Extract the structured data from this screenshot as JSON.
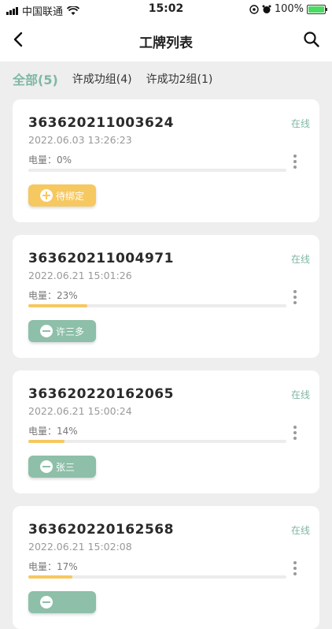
{
  "status_bar": {
    "carrier": "中国联通",
    "time": "15:02",
    "battery": "100%"
  },
  "header": {
    "title": "工牌列表"
  },
  "tabs": [
    {
      "label": "全部(5)",
      "active": true
    },
    {
      "label": "许成功组(4)",
      "active": false
    },
    {
      "label": "许成功2组(1)",
      "active": false
    }
  ],
  "cards": [
    {
      "id": "363620211003624",
      "time": "2022.06.03 13:26:23",
      "status": "在线",
      "battery_label": "电量：0%",
      "battery_level": 0,
      "tag": "待绑定",
      "tag_type": "pending"
    },
    {
      "id": "363620211004971",
      "time": "2022.06.21 15:01:26",
      "status": "在线",
      "battery_label": "电量：23%",
      "battery_level": 23,
      "tag": "许三多",
      "tag_type": "bound"
    },
    {
      "id": "363620220162065",
      "time": "2022.06.21 15:00:24",
      "status": "在线",
      "battery_label": "电量：14%",
      "battery_level": 14,
      "tag": "张三",
      "tag_type": "bound"
    },
    {
      "id": "363620220162568",
      "time": "2022.06.21 15:02:08",
      "status": "在线",
      "battery_label": "电量：17%",
      "battery_level": 17,
      "tag": "",
      "tag_type": "bound"
    }
  ]
}
